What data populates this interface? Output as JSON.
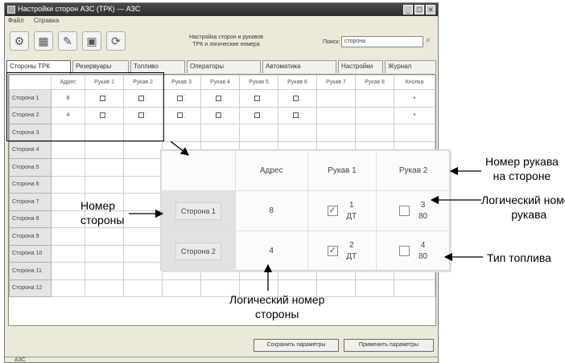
{
  "window": {
    "title": "Настройки сторон АЗС (ТРК) — АЗС",
    "menu": [
      "Файл",
      "Справка"
    ],
    "minimize": "_",
    "maximize": "□",
    "close": "×"
  },
  "toolbar": {
    "center_line1": "Настройка сторон и рукавов",
    "center_line2": "ТРК и логические номера",
    "search_label": "Поиск:",
    "search_value": "сторона",
    "icons": [
      "connect-icon",
      "table-icon",
      "edit-icon",
      "save-icon",
      "refresh-icon",
      "search-icon"
    ]
  },
  "tabs": [
    {
      "label": "Стороны ТРК"
    },
    {
      "label": "Резервуары"
    },
    {
      "label": "Топливо"
    },
    {
      "label": "Операторы"
    },
    {
      "label": "Автоматика"
    },
    {
      "label": "Настройки"
    },
    {
      "label": "Журнал"
    }
  ],
  "grid": {
    "headers": [
      "",
      "Адрес",
      "Рукав 1",
      "Рукав 2",
      "Рукав 3",
      "Рукав 4",
      "Рукав 5",
      "Рукав 6",
      "Рукав 7",
      "Рукав 8",
      "Кнопка"
    ],
    "rows": [
      {
        "label": "Сторона 1",
        "addr": "8",
        "flag": "•"
      },
      {
        "label": "Сторона 2",
        "addr": "4",
        "flag": "•"
      },
      {
        "label": "Сторона 3"
      },
      {
        "label": "Сторона 4"
      },
      {
        "label": "Сторона 5"
      },
      {
        "label": "Сторона 6"
      },
      {
        "label": "Сторона 7"
      },
      {
        "label": "Сторона 8"
      },
      {
        "label": "Сторона 9"
      },
      {
        "label": "Сторона 10"
      },
      {
        "label": "Сторона 11"
      },
      {
        "label": "Сторона 12"
      }
    ]
  },
  "buttons": {
    "save": "Сохранить параметры",
    "apply": "Применить параметры"
  },
  "status": {
    "text": "АЗС"
  },
  "popup": {
    "headers": [
      "Адрес",
      "Рукав 1",
      "Рукав 2"
    ],
    "rows": [
      {
        "side": "Сторона 1",
        "addr": "8",
        "h1_num": "1",
        "h1_fuel": "ДТ",
        "h1_checked": true,
        "h2_num": "3",
        "h2_fuel": "80",
        "h2_checked": false
      },
      {
        "side": "Сторона 2",
        "addr": "4",
        "h1_num": "2",
        "h1_fuel": "ДТ",
        "h1_checked": true,
        "h2_num": "4",
        "h2_fuel": "80",
        "h2_checked": false
      }
    ]
  },
  "annotations": {
    "side_number": "Номер\nстороны",
    "hose_number": "Номер рукава\nна стороне",
    "logical_hose": "Логический номер\nрукава",
    "fuel_type": "Тип топлива",
    "logical_side": "Логический номер\nстороны"
  }
}
